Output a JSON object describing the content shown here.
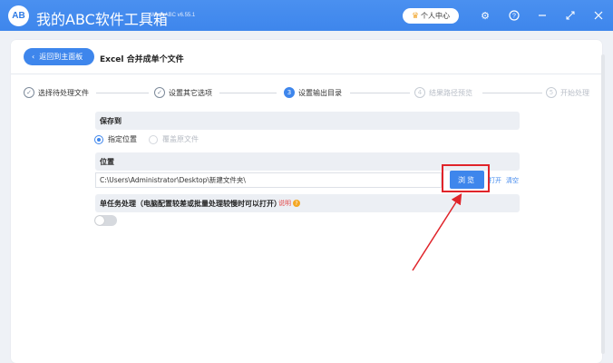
{
  "app": {
    "logo_text": "AB",
    "title": "我的ABC软件工具箱",
    "version": "WodeABC v6.55.1",
    "user_center_label": "个人中心"
  },
  "window_controls": [
    "settings-icon",
    "help-icon",
    "minimize-icon",
    "maximize-icon",
    "close-icon"
  ],
  "toolbar": {
    "back_label": "返回到主面板",
    "page_title": "Excel 合并成单个文件"
  },
  "steps": [
    {
      "num": "✓",
      "label": "选择待处理文件",
      "state": "done"
    },
    {
      "num": "✓",
      "label": "设置其它选项",
      "state": "done"
    },
    {
      "num": "3",
      "label": "设置输出目录",
      "state": "active"
    },
    {
      "num": "4",
      "label": "结果路径预览",
      "state": "disabled"
    },
    {
      "num": "5",
      "label": "开始处理",
      "state": "disabled"
    }
  ],
  "save_to": {
    "heading": "保存到",
    "option_specified": "指定位置",
    "option_overwrite": "覆盖原文件"
  },
  "location": {
    "heading": "位置",
    "path_value": "C:\\Users\\Administrator\\Desktop\\新建文件夹\\",
    "browse_label": "浏览",
    "open_label": "打开",
    "clear_label": "清空"
  },
  "single_task": {
    "heading": "单任务处理（电脑配置较差或批量处理较慢时可以打开）",
    "help_label": "说明",
    "enabled": false
  },
  "colors": {
    "accent": "#3e86ec",
    "highlight": "#e0242a"
  }
}
